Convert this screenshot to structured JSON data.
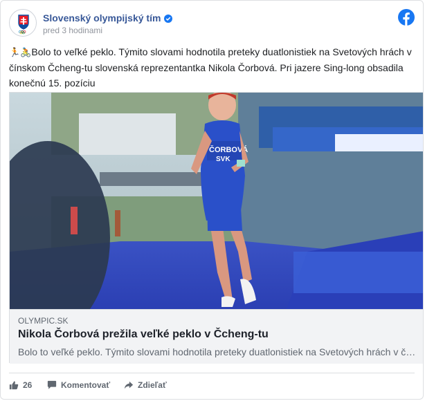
{
  "post": {
    "page_name": "Slovenský olympijský tím",
    "timestamp": "pred 3 hodinami",
    "emojis": "🏃🚴",
    "text": "Bolo to veľké peklo. Týmito slovami hodnotila preteky duatlonistiek na Svetových hrách v čínskom Čcheng-tu slovenská reprezentantka Nikola Čorbová. Pri jazere Sing-long obsadila konečnú 15. pozíciu"
  },
  "link_preview": {
    "domain": "OLYMPIC.SK",
    "title": "Nikola Čorbová prežila veľké peklo v Čcheng-tu",
    "description": "Bolo to veľké peklo. Týmito slovami hodnotila preteky duatlonistiek na Svetových hrách v čínskom Čcheng-tu slovenská reprezentantka Nikola Čorbová.",
    "photo_text": {
      "bib_name": "ČORBOVÁ",
      "bib_country": "SVK"
    }
  },
  "actions": {
    "like_count": "26",
    "comment_label": "Komentovať",
    "share_label": "Zdieľať"
  },
  "colors": {
    "page_name": "#385898",
    "facebook_blue": "#1877f2",
    "secondary_text": "#606770",
    "track_blue": "#2f49c8"
  }
}
